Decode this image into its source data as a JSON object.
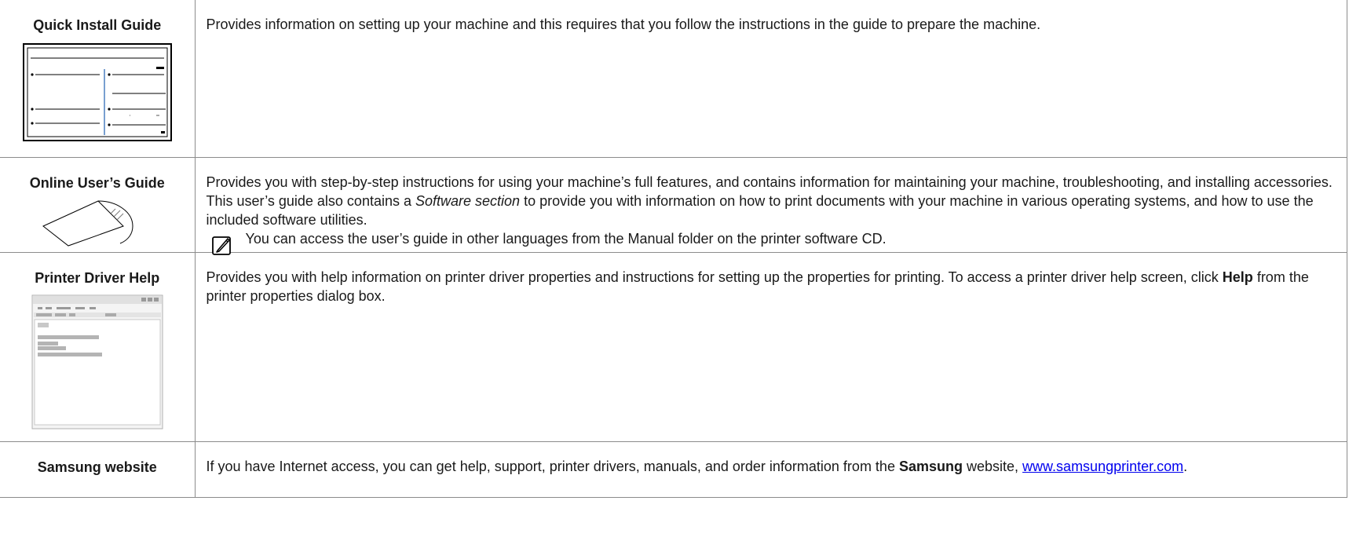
{
  "rows": [
    {
      "title": "Quick Install Guide",
      "illustration": "quick-install-guide-thumbnail",
      "desc": "Provides information on setting up your machine and this requires that you follow the instructions in the guide to prepare the machine."
    },
    {
      "title": "Online User’s Guide",
      "illustration": "cd-in-sleeve",
      "desc_1": "Provides you with step-by-step instructions for using your machine’s full features, and contains information for maintaining your machine, troubleshooting, and installing accessories.",
      "desc_2_pre": "This user’s guide also contains a ",
      "desc_2_em": "Software section",
      "desc_2_post": " to provide you with information on how to print documents with your machine in various operating systems, and how to use the included software utilities.",
      "note_icon": "note-pencil-icon",
      "note": "You can access the user’s guide in other languages from the Manual folder on the printer software CD."
    },
    {
      "title": "Printer Driver Help",
      "illustration": "help-window-thumbnail",
      "desc_pre": "Provides you with help information on printer driver properties and instructions for setting up the properties for printing. To access a printer driver help screen, click ",
      "desc_bold": "Help",
      "desc_post": " from the printer properties dialog box."
    },
    {
      "title": "Samsung website",
      "desc_pre": "If you have Internet access, you can get help, support, printer drivers, manuals, and order information from the ",
      "desc_bold": "Samsung",
      "desc_mid": " website, ",
      "link": "www.samsungprinter.com",
      "desc_post": "."
    }
  ],
  "colors": {
    "border": "#8c8c8c",
    "link": "#0000ee",
    "guide_divider": "#4a7fc1"
  }
}
